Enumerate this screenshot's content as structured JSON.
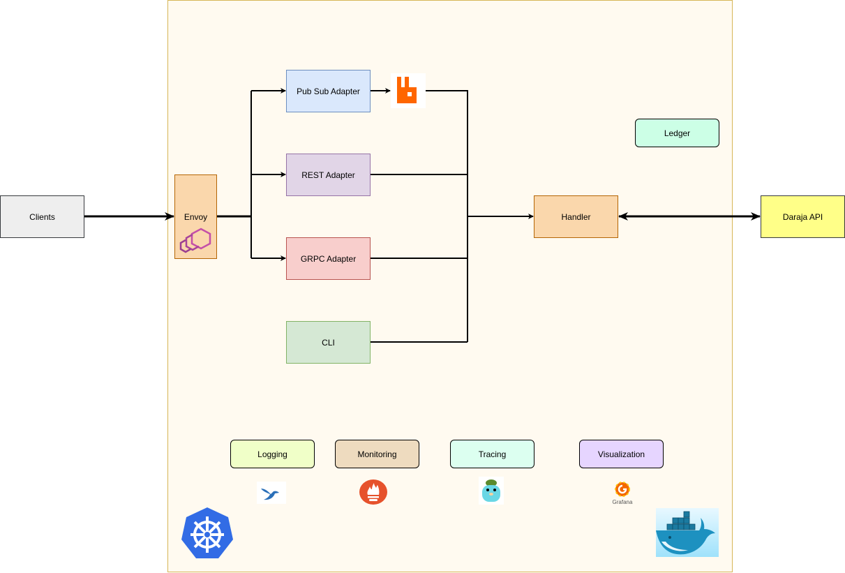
{
  "nodes": {
    "clients": "Clients",
    "envoy": "Envoy",
    "pubsub": "Pub Sub Adapter",
    "rest": "REST Adapter",
    "grpc": "GRPC Adapter",
    "cli": "CLI",
    "handler": "Handler",
    "daraja": "Daraja API",
    "ledger": "Ledger"
  },
  "observability": {
    "logging": "Logging",
    "monitoring": "Monitoring",
    "tracing": "Tracing",
    "visualization": "Visualization"
  },
  "logos": {
    "grafana": "Grafana"
  },
  "icons": [
    "envoy-icon",
    "rabbitmq-icon",
    "fluentd-icon",
    "prometheus-icon",
    "jaeger-gopher-icon",
    "grafana-icon",
    "kubernetes-icon",
    "docker-icon"
  ],
  "colors": {
    "container_fill": "#fffaf0",
    "container_stroke": "#d6b656"
  }
}
